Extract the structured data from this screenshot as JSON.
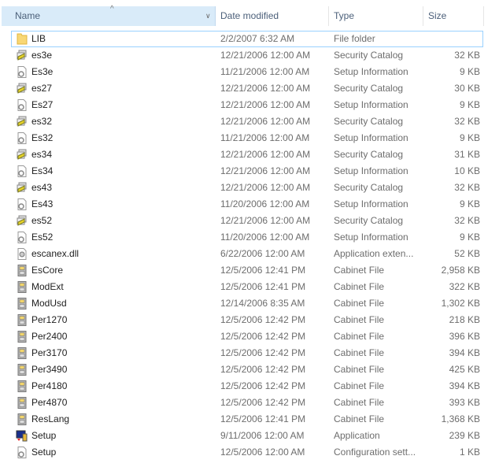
{
  "columns": {
    "name": "Name",
    "date": "Date modified",
    "type": "Type",
    "size": "Size"
  },
  "files": [
    {
      "name": "LIB",
      "date": "2/2/2007 6:32 AM",
      "type": "File folder",
      "size": "",
      "icon": "folder-icon"
    },
    {
      "name": "es3e",
      "date": "12/21/2006 12:00 AM",
      "type": "Security Catalog",
      "size": "32 KB",
      "icon": "security-catalog-icon"
    },
    {
      "name": "Es3e",
      "date": "11/21/2006 12:00 AM",
      "type": "Setup Information",
      "size": "9 KB",
      "icon": "setup-information-icon"
    },
    {
      "name": "es27",
      "date": "12/21/2006 12:00 AM",
      "type": "Security Catalog",
      "size": "30 KB",
      "icon": "security-catalog-icon"
    },
    {
      "name": "Es27",
      "date": "12/21/2006 12:00 AM",
      "type": "Setup Information",
      "size": "9 KB",
      "icon": "setup-information-icon"
    },
    {
      "name": "es32",
      "date": "12/21/2006 12:00 AM",
      "type": "Security Catalog",
      "size": "32 KB",
      "icon": "security-catalog-icon"
    },
    {
      "name": "Es32",
      "date": "11/21/2006 12:00 AM",
      "type": "Setup Information",
      "size": "9 KB",
      "icon": "setup-information-icon"
    },
    {
      "name": "es34",
      "date": "12/21/2006 12:00 AM",
      "type": "Security Catalog",
      "size": "31 KB",
      "icon": "security-catalog-icon"
    },
    {
      "name": "Es34",
      "date": "12/21/2006 12:00 AM",
      "type": "Setup Information",
      "size": "10 KB",
      "icon": "setup-information-icon"
    },
    {
      "name": "es43",
      "date": "12/21/2006 12:00 AM",
      "type": "Security Catalog",
      "size": "32 KB",
      "icon": "security-catalog-icon"
    },
    {
      "name": "Es43",
      "date": "11/20/2006 12:00 AM",
      "type": "Setup Information",
      "size": "9 KB",
      "icon": "setup-information-icon"
    },
    {
      "name": "es52",
      "date": "12/21/2006 12:00 AM",
      "type": "Security Catalog",
      "size": "32 KB",
      "icon": "security-catalog-icon"
    },
    {
      "name": "Es52",
      "date": "11/20/2006 12:00 AM",
      "type": "Setup Information",
      "size": "9 KB",
      "icon": "setup-information-icon"
    },
    {
      "name": "escanex.dll",
      "date": "6/22/2006 12:00 AM",
      "type": "Application exten...",
      "size": "52 KB",
      "icon": "dll-icon"
    },
    {
      "name": "EsCore",
      "date": "12/5/2006 12:41 PM",
      "type": "Cabinet File",
      "size": "2,958 KB",
      "icon": "cabinet-icon"
    },
    {
      "name": "ModExt",
      "date": "12/5/2006 12:41 PM",
      "type": "Cabinet File",
      "size": "322 KB",
      "icon": "cabinet-icon"
    },
    {
      "name": "ModUsd",
      "date": "12/14/2006 8:35 AM",
      "type": "Cabinet File",
      "size": "1,302 KB",
      "icon": "cabinet-icon"
    },
    {
      "name": "Per1270",
      "date": "12/5/2006 12:42 PM",
      "type": "Cabinet File",
      "size": "218 KB",
      "icon": "cabinet-icon"
    },
    {
      "name": "Per2400",
      "date": "12/5/2006 12:42 PM",
      "type": "Cabinet File",
      "size": "396 KB",
      "icon": "cabinet-icon"
    },
    {
      "name": "Per3170",
      "date": "12/5/2006 12:42 PM",
      "type": "Cabinet File",
      "size": "394 KB",
      "icon": "cabinet-icon"
    },
    {
      "name": "Per3490",
      "date": "12/5/2006 12:42 PM",
      "type": "Cabinet File",
      "size": "425 KB",
      "icon": "cabinet-icon"
    },
    {
      "name": "Per4180",
      "date": "12/5/2006 12:42 PM",
      "type": "Cabinet File",
      "size": "394 KB",
      "icon": "cabinet-icon"
    },
    {
      "name": "Per4870",
      "date": "12/5/2006 12:42 PM",
      "type": "Cabinet File",
      "size": "393 KB",
      "icon": "cabinet-icon"
    },
    {
      "name": "ResLang",
      "date": "12/5/2006 12:41 PM",
      "type": "Cabinet File",
      "size": "1,368 KB",
      "icon": "cabinet-icon"
    },
    {
      "name": "Setup",
      "date": "9/11/2006 12:00 AM",
      "type": "Application",
      "size": "239 KB",
      "icon": "setup-application-icon"
    },
    {
      "name": "Setup",
      "date": "12/5/2006 12:00 AM",
      "type": "Configuration sett...",
      "size": "1 KB",
      "icon": "configuration-settings-icon"
    }
  ]
}
